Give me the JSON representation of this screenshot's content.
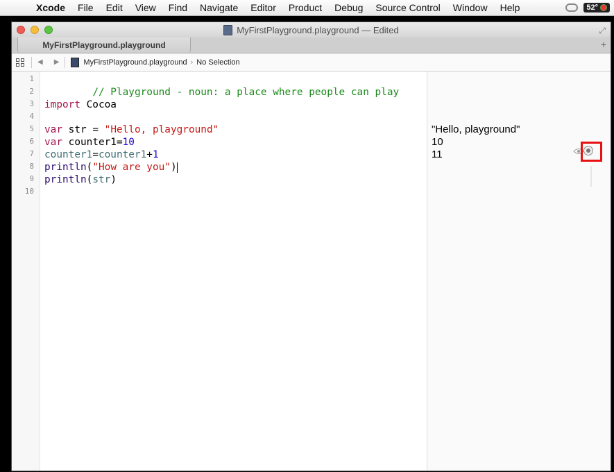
{
  "menubar": {
    "app": "Xcode",
    "items": [
      "File",
      "Edit",
      "View",
      "Find",
      "Navigate",
      "Editor",
      "Product",
      "Debug",
      "Source Control",
      "Window",
      "Help"
    ],
    "temperature": "52°"
  },
  "window": {
    "title": "MyFirstPlayground.playground — Edited",
    "tab_label": "MyFirstPlayground.playground",
    "tab_add": "+"
  },
  "jumpbar": {
    "file": "MyFirstPlayground.playground",
    "selection": "No Selection"
  },
  "editor": {
    "line_numbers": [
      "1",
      "2",
      "3",
      "4",
      "5",
      "6",
      "7",
      "8",
      "9",
      "10"
    ],
    "lines": {
      "l1": "// Playground - noun: a place where people can play",
      "l3_kw": "import",
      "l3_rest": " Cocoa",
      "l5_kw": "var",
      "l5_mid": " str = ",
      "l5_str": "\"Hello, playground\"",
      "l6_kw": "var",
      "l6_mid": " counter1=",
      "l6_num": "10",
      "l7_a": "counter1",
      "l7_eq": "=",
      "l7_b": "counter1",
      "l7_plus": "+",
      "l7_num": "1",
      "l8_fn": "println",
      "l8_open": "(",
      "l8_str": "\"How are you\"",
      "l8_close": ")",
      "l9_fn": "println",
      "l9_open": "(",
      "l9_var": "str",
      "l9_close": ")"
    }
  },
  "results": {
    "r5": "\"Hello, playground\"",
    "r6": "10",
    "r7": "11"
  },
  "icons": {
    "apple": "apple-logo-icon",
    "quick_look": "eye-icon",
    "value_history": "circle-button-icon"
  },
  "colors": {
    "highlight": "#e81010",
    "comment": "#1a8a1a",
    "keyword": "#a5154e",
    "string": "#c41a16",
    "number": "#1c00cf"
  }
}
